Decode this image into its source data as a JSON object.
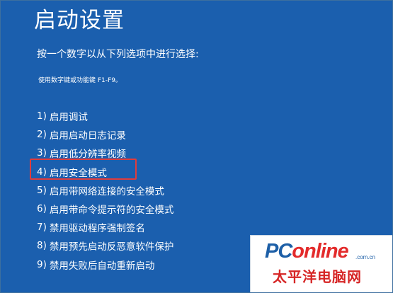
{
  "page": {
    "title": "启动设置",
    "subtitle": "按一个数字以从下列选项中进行选择:",
    "hint": "使用数字键或功能键 F1-F9。"
  },
  "options": [
    {
      "num": "1)",
      "label": "启用调试"
    },
    {
      "num": "2)",
      "label": "启用启动日志记录"
    },
    {
      "num": "3)",
      "label": "启用低分辨率视频"
    },
    {
      "num": "4)",
      "label": "启用安全模式"
    },
    {
      "num": "5)",
      "label": "启用带网络连接的安全模式"
    },
    {
      "num": "6)",
      "label": "启用带命令提示符的安全模式"
    },
    {
      "num": "7)",
      "label": "禁用驱动程序强制签名"
    },
    {
      "num": "8)",
      "label": "禁用预先启动反恶意软件保护"
    },
    {
      "num": "9)",
      "label": "禁用失败后自动重新启动"
    }
  ],
  "highlighted_option": "4)",
  "watermark": {
    "logo_part1": "PC",
    "logo_part2": "online",
    "domain": ".com.cn",
    "name_cn": "太平洋电脑网"
  },
  "colors": {
    "background": "#1b5fae",
    "text": "#ffffff",
    "highlight": "#e03c3c",
    "brand_blue": "#1d5fa7",
    "brand_red": "#e32b2b"
  }
}
